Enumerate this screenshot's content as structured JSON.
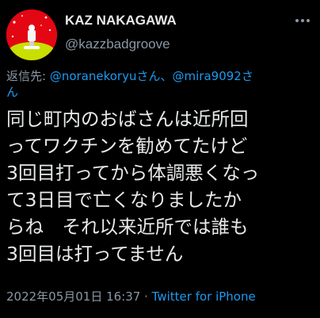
{
  "user": {
    "display_name": "KAZ NAKAGAWA",
    "handle": "@kazzbadgroove"
  },
  "reply": {
    "prefix": "返信先: ",
    "mention_1": "@noranekoryu",
    "joiner_1": "さん、",
    "mention_2": "@mira9092",
    "joiner_2": "さ",
    "wrap": "ん"
  },
  "tweet": {
    "lines": [
      "同じ町内のおばさんは近所回",
      "ってワクチンを勧めてたけど",
      "3回目打ってから体調悪くなっ",
      "て3日目で亡くなりましたか",
      "らね　それ以来近所では誰も",
      "3回目は打ってません"
    ]
  },
  "meta": {
    "timestamp": "2022年05月01日 16:37",
    "separator": " · ",
    "source": "Twitter for iPhone"
  },
  "icons": {
    "more": "more-dots-icon",
    "avatar": "avatar-image"
  },
  "colors": {
    "background": "#000000",
    "text": "#e7e9ea",
    "muted": "#8b98a5",
    "link": "#1d9bf0",
    "avatar_bg": "#e30613"
  }
}
